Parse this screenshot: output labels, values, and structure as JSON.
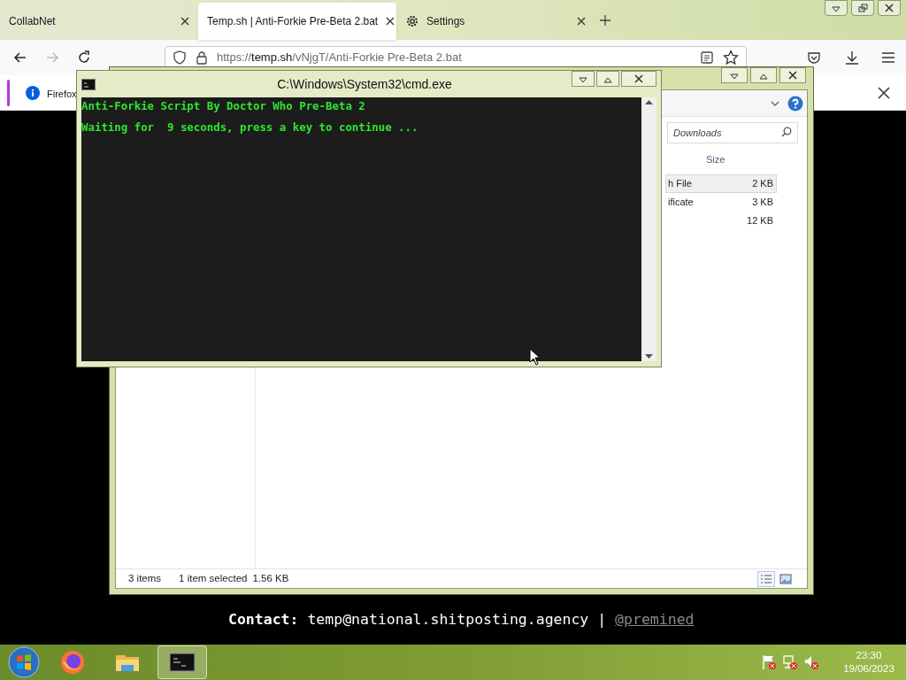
{
  "browser": {
    "tabs": [
      {
        "label": "CollabNet",
        "kind": "page",
        "selected": false
      },
      {
        "label": "Temp.sh | Anti-Forkie Pre-Beta 2.bat",
        "kind": "page",
        "selected": true
      },
      {
        "label": "Settings",
        "kind": "settings",
        "selected": false
      }
    ],
    "nav": [
      {
        "kind": "back",
        "disabled": false
      },
      {
        "kind": "forward",
        "disabled": true
      },
      {
        "kind": "reload",
        "disabled": false
      }
    ],
    "url": "https://**temp.sh**/vNjgT/Anti-Forkie Pre-Beta 2.bat",
    "notification": {
      "text": "Firefox"
    }
  },
  "explorer": {
    "search": {
      "placeholder": "Downloads"
    },
    "columns": [
      {
        "label": "Size"
      }
    ],
    "rows": [
      {
        "type": "h File",
        "size": "2 KB",
        "selected": true
      },
      {
        "type": "ificate",
        "size": "3 KB",
        "selected": false
      },
      {
        "size": "12 KB",
        "selected": false
      }
    ],
    "status": {
      "count": "3 items",
      "selection": "1 item selected",
      "size": "1.56 KB"
    }
  },
  "console": {
    "title": "C:\\Windows\\System32\\cmd.exe",
    "lines": [
      "Anti-Forkie Script By Doctor Who Pre-Beta 2",
      "Waiting for  9 seconds, press a key to continue ..."
    ]
  },
  "page": {
    "contact": "**Contact:** temp@national.shitposting.agency |",
    "handle": "@premined"
  },
  "taskbar": {
    "apps": [
      {
        "kind": "firefox",
        "active": false
      },
      {
        "kind": "explorer",
        "active": false
      },
      {
        "kind": "console",
        "active": true
      }
    ],
    "clock": {
      "time": "23:30",
      "date": "19/06/2023"
    }
  }
}
